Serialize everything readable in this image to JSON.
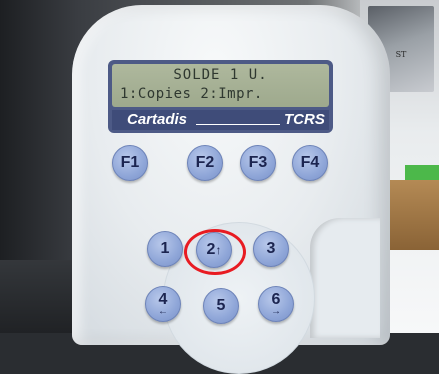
{
  "device": {
    "brand_top": "",
    "lcd": {
      "line1": "SOLDE 1 U.",
      "line2": "1:Copies 2:Impr."
    },
    "brand_name": "Cartadis",
    "model": "TCRS"
  },
  "function_keys": [
    "F1",
    "F2",
    "F3",
    "F4"
  ],
  "numeric_keys": [
    {
      "label": "1",
      "arrow": ""
    },
    {
      "label": "2",
      "arrow": "↑"
    },
    {
      "label": "3",
      "arrow": ""
    },
    {
      "label": "4",
      "arrow": "←"
    },
    {
      "label": "5",
      "arrow": ""
    },
    {
      "label": "6",
      "arrow": "→"
    }
  ],
  "highlight": {
    "key": "2",
    "color": "#e81b22"
  },
  "background": {
    "poster_text": "ST"
  },
  "colors": {
    "lcd_green": "#a6b195",
    "panel_blue": "#3f4c79",
    "key_blue": "#8fa6d8"
  }
}
